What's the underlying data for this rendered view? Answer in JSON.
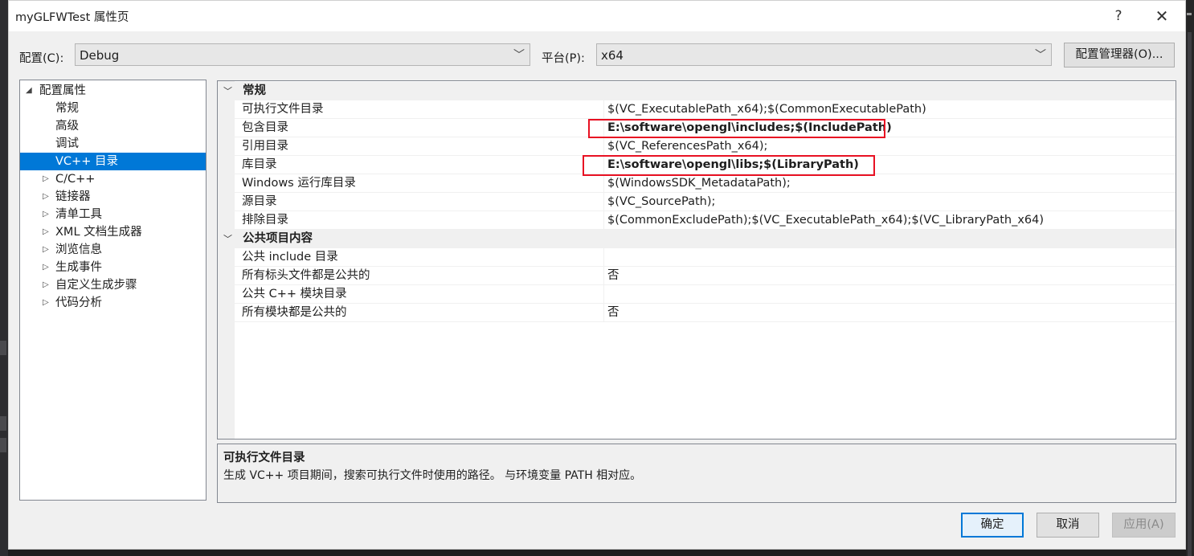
{
  "window": {
    "title": "myGLFWTest 属性页",
    "help": "?",
    "close": "✕"
  },
  "config_bar": {
    "config_label": "配置(C):",
    "config_value": "Debug",
    "platform_label": "平台(P):",
    "platform_value": "x64",
    "manager_button": "配置管理器(O)..."
  },
  "tree": {
    "root": "配置属性",
    "children": [
      "常规",
      "高级",
      "调试",
      "VC++ 目录"
    ],
    "selected": "VC++ 目录",
    "collapsed": [
      "C/C++",
      "链接器",
      "清单工具",
      "XML 文档生成器",
      "浏览信息",
      "生成事件",
      "自定义生成步骤",
      "代码分析"
    ]
  },
  "grid": {
    "categories": [
      {
        "title": "常规",
        "rows": [
          {
            "name": "可执行文件目录",
            "value": "$(VC_ExecutablePath_x64);$(CommonExecutablePath)",
            "bold": false
          },
          {
            "name": "包含目录",
            "value": "E:\\software\\opengl\\includes;$(IncludePath)",
            "bold": true
          },
          {
            "name": "引用目录",
            "value": "$(VC_ReferencesPath_x64);",
            "bold": false
          },
          {
            "name": "库目录",
            "value": "E:\\software\\opengl\\libs;$(LibraryPath)",
            "bold": true
          },
          {
            "name": "Windows 运行库目录",
            "value": "$(WindowsSDK_MetadataPath);",
            "bold": false
          },
          {
            "name": "源目录",
            "value": "$(VC_SourcePath);",
            "bold": false
          },
          {
            "name": "排除目录",
            "value": "$(CommonExcludePath);$(VC_ExecutablePath_x64);$(VC_LibraryPath_x64)",
            "bold": false
          }
        ]
      },
      {
        "title": "公共项目内容",
        "rows": [
          {
            "name": "公共 include 目录",
            "value": "",
            "bold": false
          },
          {
            "name": "所有标头文件都是公共的",
            "value": "否",
            "bold": false
          },
          {
            "name": "公共 C++ 模块目录",
            "value": "",
            "bold": false
          },
          {
            "name": "所有模块都是公共的",
            "value": "否",
            "bold": false
          }
        ]
      }
    ],
    "highlight_color": "#e81123"
  },
  "description": {
    "title": "可执行文件目录",
    "text": "生成 VC++ 项目期间，搜索可执行文件时使用的路径。 与环境变量 PATH 相对应。"
  },
  "footer": {
    "ok": "确定",
    "cancel": "取消",
    "apply": "应用(A)"
  },
  "colors": {
    "selection": "#0078d7",
    "dialog_bg": "#f0f0f0"
  }
}
